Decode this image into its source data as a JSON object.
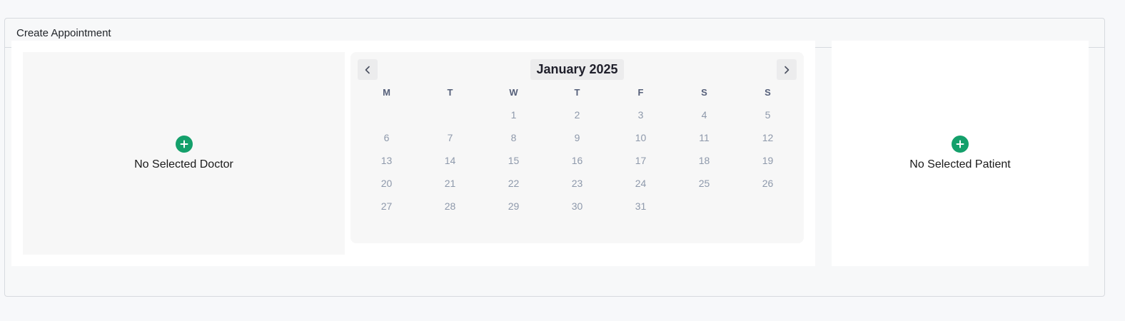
{
  "card": {
    "title": "Create Appointment"
  },
  "doctor": {
    "empty_label": "No Selected Doctor",
    "add_icon": "plus-icon"
  },
  "patient": {
    "empty_label": "No Selected Patient",
    "add_icon": "plus-icon"
  },
  "calendar": {
    "month_label": "January 2025",
    "prev_icon": "chevron-left-icon",
    "next_icon": "chevron-right-icon",
    "weekdays": [
      "M",
      "T",
      "W",
      "T",
      "F",
      "S",
      "S"
    ],
    "leading_blanks": 2,
    "days": [
      "1",
      "2",
      "3",
      "4",
      "5",
      "6",
      "7",
      "8",
      "9",
      "10",
      "11",
      "12",
      "13",
      "14",
      "15",
      "16",
      "17",
      "18",
      "19",
      "20",
      "21",
      "22",
      "23",
      "24",
      "25",
      "26",
      "27",
      "28",
      "29",
      "30",
      "31"
    ]
  },
  "colors": {
    "accent": "#14a06b",
    "day_text": "#8e99ab",
    "weekday_text": "#56607a"
  }
}
